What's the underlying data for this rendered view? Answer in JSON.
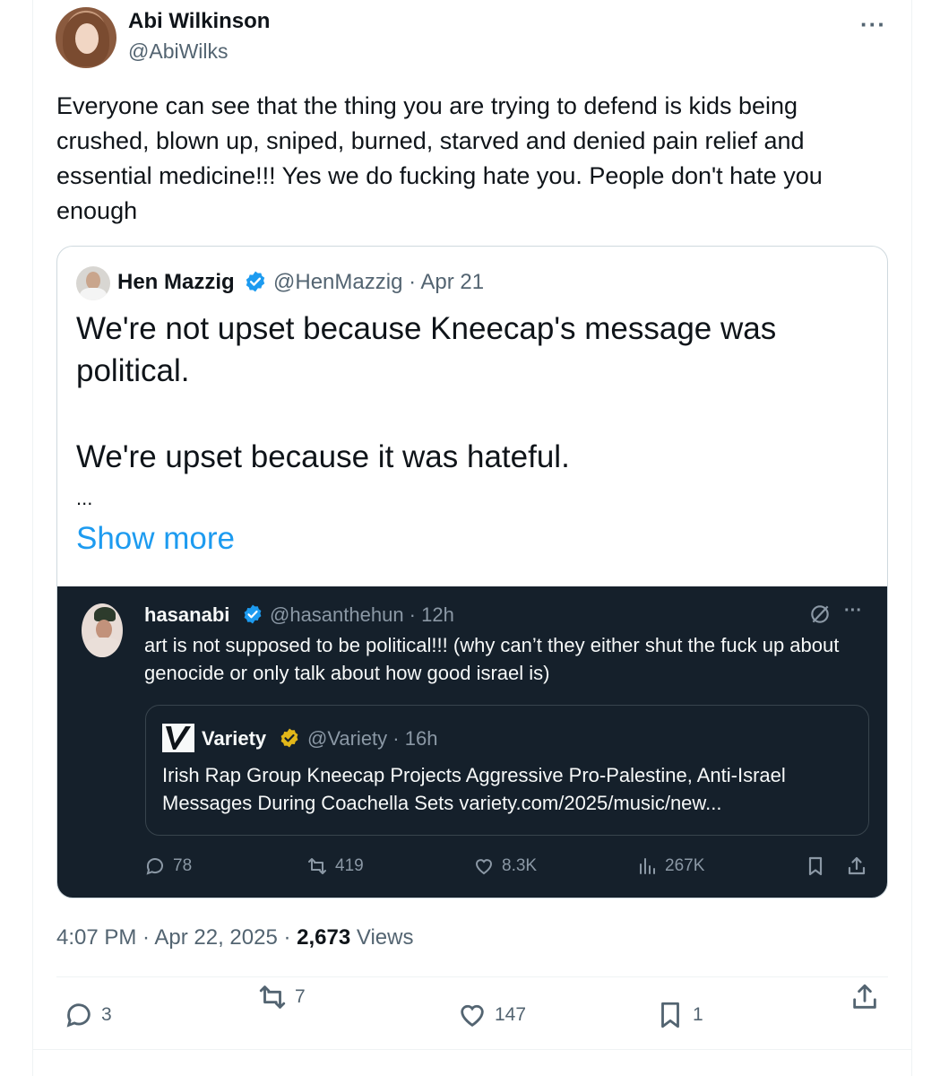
{
  "tweet": {
    "author_name": "Abi Wilkinson",
    "author_handle": "@AbiWilks",
    "more_icon": "more-horizontal-icon",
    "text": "Everyone can see that the thing you are trying to defend is kids being crushed, blown up, sniped, burned, starved and denied pain relief and essential medicine!!! Yes we do fucking hate you. People don't hate you enough",
    "timestamp": "4:07 PM · Apr 22, 2025 · ",
    "views_count": "2,673",
    "views_label": " Views",
    "actions": {
      "replies": "3",
      "reposts": "7",
      "likes": "147",
      "bookmarks": "1"
    }
  },
  "quote": {
    "author_name": "Hen Mazzig",
    "author_handle": "@HenMazzig · Apr 21",
    "paragraph1": "We're not upset because Kneecap's message was political.",
    "paragraph2": "We're upset because it was hateful.",
    "ellipsis": "...",
    "show_more": "Show more"
  },
  "embedded_image": {
    "author_name": "hasanabi",
    "author_handle": "@hasanthehun · 12h",
    "text": "art is not supposed to be political!!! (why can’t they either shut the fuck up about genocide or only talk about how good israel is)",
    "inner_quote": {
      "author_name": "Variety",
      "author_handle": "@Variety · 16h",
      "text": "Irish Rap Group Kneecap Projects Aggressive Pro-Palestine, Anti-Israel Messages During Coachella Sets variety.com/2025/music/new..."
    },
    "actions": {
      "replies": "78",
      "reposts": "419",
      "likes": "8.3K",
      "views": "267K"
    }
  },
  "colors": {
    "accent": "#1d9bf0",
    "verified_blue": "#1d9bf0",
    "verified_gold": "#e2b719",
    "dark_bg": "#15202b",
    "secondary_text": "#536471"
  }
}
